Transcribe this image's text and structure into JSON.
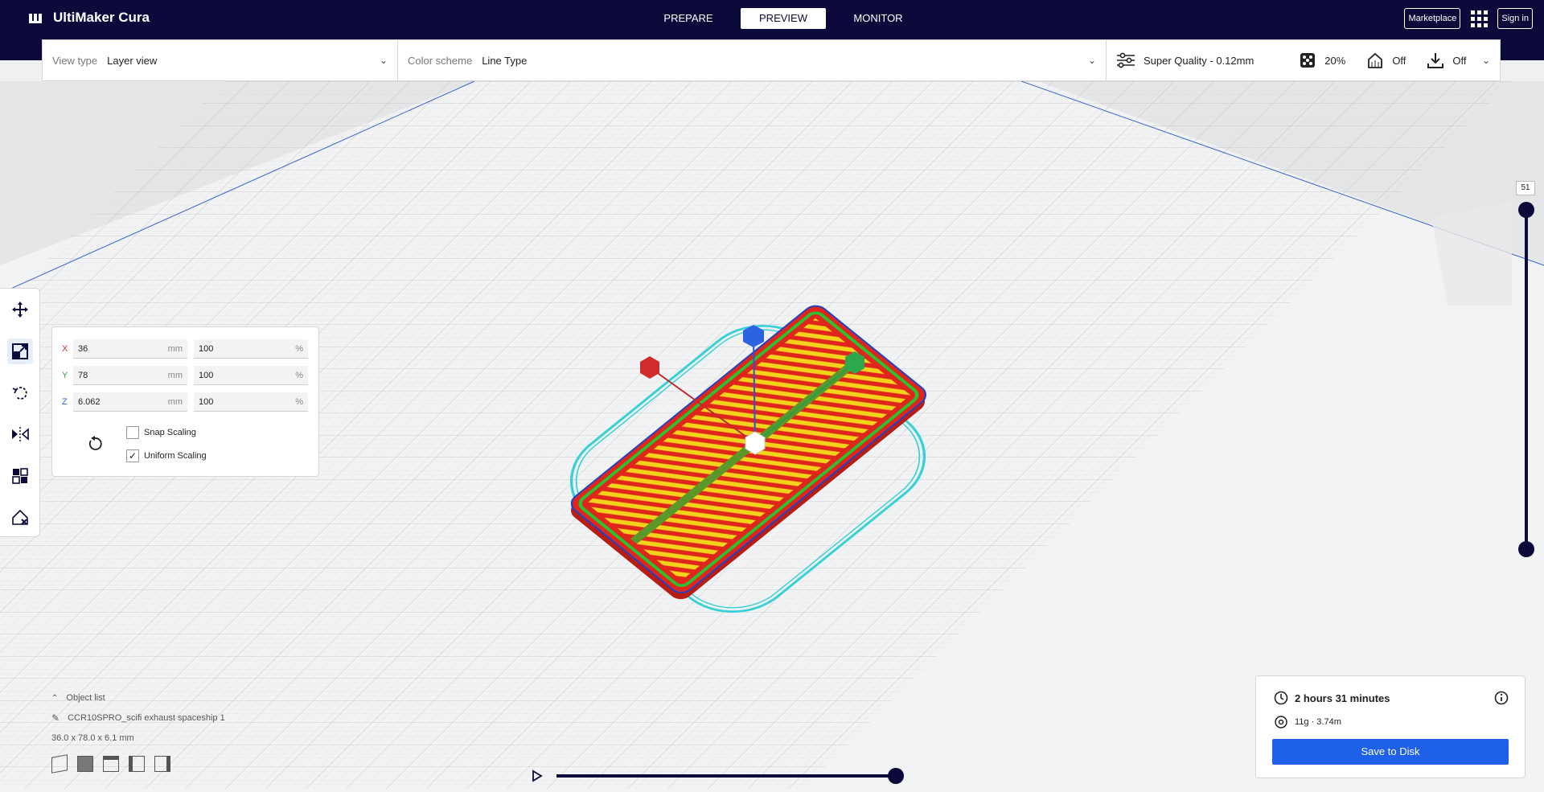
{
  "app": {
    "name": "UltiMaker Cura"
  },
  "stages": [
    {
      "label": "PREPARE",
      "active": false
    },
    {
      "label": "PREVIEW",
      "active": true
    },
    {
      "label": "MONITOR",
      "active": false
    }
  ],
  "topright": {
    "marketplace": "Marketplace",
    "signin": "Sign in",
    "apps_icon": "grid-icon"
  },
  "view_type": {
    "label": "View type",
    "value": "Layer view"
  },
  "color_scheme": {
    "label": "Color scheme",
    "value": "Line Type"
  },
  "print_settings": {
    "profile": "Super Quality - 0.12mm",
    "infill": "20%",
    "support": "Off",
    "adhesion": "Off"
  },
  "tools": [
    "move-icon",
    "scale-icon",
    "rotate-icon",
    "mirror-icon",
    "per-model-settings-icon",
    "support-blocker-icon"
  ],
  "scale": {
    "x": {
      "axis": "X",
      "mm": "36",
      "pct": "100"
    },
    "y": {
      "axis": "Y",
      "mm": "78",
      "pct": "100"
    },
    "z": {
      "axis": "Z",
      "mm": "6.062",
      "pct": "100"
    },
    "unit_mm": "mm",
    "unit_pct": "%",
    "snap_scaling": {
      "label": "Snap Scaling",
      "checked": false
    },
    "uniform_scaling": {
      "label": "Uniform Scaling",
      "checked": true
    }
  },
  "layer_slider": {
    "value": "51"
  },
  "object_list": {
    "title": "Object list",
    "object_name": "CCR10SPRO_scifi exhaust spaceship 1",
    "dimensions": "36.0 x 78.0 x 6.1 mm"
  },
  "print_info": {
    "time": "2 hours 31 minutes",
    "material": "11g · 3.74m",
    "save_label": "Save to Disk"
  },
  "colors": {
    "navy": "#0b0a3b",
    "accent": "#1e61e8",
    "shell": "#e0261c",
    "infill": "#f2d21b",
    "skirt": "#35d0d8",
    "inner_wall": "#2ec02e",
    "outer_wall": "#1d43c9"
  }
}
